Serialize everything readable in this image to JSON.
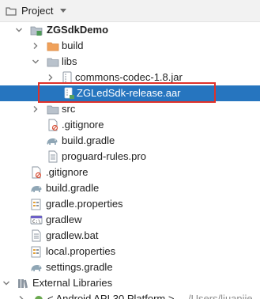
{
  "header": {
    "title": "Project"
  },
  "tree": [
    {
      "name": "zgsdkdemo",
      "label": "ZGSdkDemo",
      "bold": true,
      "arrow": "down",
      "icon": "module-folder"
    },
    {
      "name": "build",
      "label": "build",
      "arrow": "right",
      "icon": "orange-folder"
    },
    {
      "name": "libs",
      "label": "libs",
      "arrow": "down",
      "icon": "gray-folder"
    },
    {
      "name": "commons-codec",
      "label": "commons-codec-1.8.jar",
      "arrow": "right",
      "icon": "jar"
    },
    {
      "name": "zgledsdk",
      "label": "ZGLedSdk-release.aar",
      "arrow": "none",
      "icon": "aar",
      "selected": true
    },
    {
      "name": "src",
      "label": "src",
      "arrow": "right",
      "icon": "gray-folder"
    },
    {
      "name": "gitignore-module",
      "label": ".gitignore",
      "arrow": "none",
      "icon": "ignore-file"
    },
    {
      "name": "build-gradle-module",
      "label": "build.gradle",
      "arrow": "none",
      "icon": "gradle"
    },
    {
      "name": "proguard-rules",
      "label": "proguard-rules.pro",
      "arrow": "none",
      "icon": "text-file"
    },
    {
      "name": "gitignore-root",
      "label": ".gitignore",
      "arrow": "none",
      "icon": "ignore-file"
    },
    {
      "name": "build-gradle-root",
      "label": "build.gradle",
      "arrow": "none",
      "icon": "gradle"
    },
    {
      "name": "gradle-properties",
      "label": "gradle.properties",
      "arrow": "none",
      "icon": "properties"
    },
    {
      "name": "gradlew",
      "label": "gradlew",
      "arrow": "none",
      "icon": "script"
    },
    {
      "name": "gradlew-bat",
      "label": "gradlew.bat",
      "arrow": "none",
      "icon": "text-file"
    },
    {
      "name": "local-properties",
      "label": "local.properties",
      "arrow": "none",
      "icon": "properties"
    },
    {
      "name": "settings-gradle",
      "label": "settings.gradle",
      "arrow": "none",
      "icon": "gradle"
    },
    {
      "name": "external-libraries",
      "label": "External Libraries",
      "arrow": "down",
      "icon": "libraries"
    },
    {
      "name": "android-api",
      "label": "< Android API 30 Platform >",
      "suffix": "/Users/liuanjie",
      "arrow": "right",
      "icon": "android"
    }
  ]
}
